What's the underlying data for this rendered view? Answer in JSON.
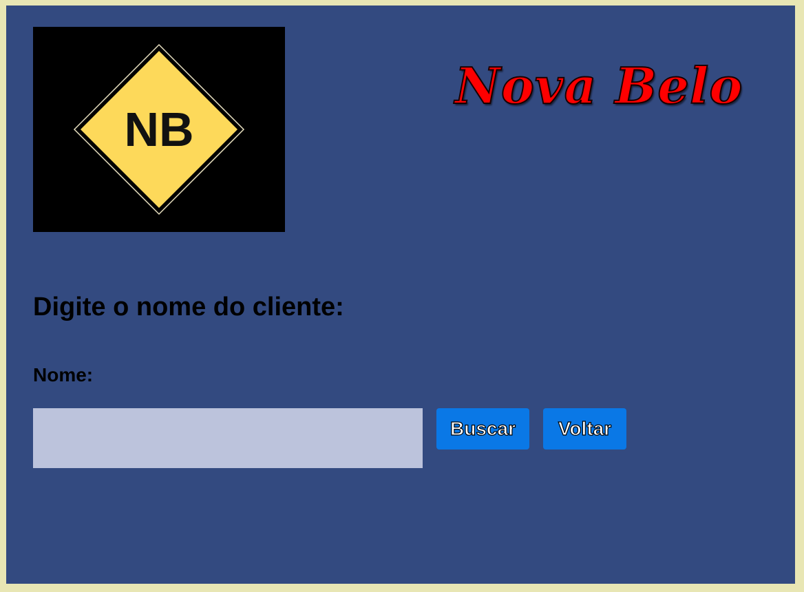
{
  "brand": {
    "logo_text": "NB",
    "title": "Nova Belo"
  },
  "form": {
    "heading": "Digite o nome do cliente:",
    "name_label": "Nome:",
    "name_value": "",
    "name_placeholder": ""
  },
  "actions": {
    "search_label": "Buscar",
    "back_label": "Voltar"
  },
  "colors": {
    "page_border": "#e8e6b4",
    "panel_background": "#334a80",
    "title_red": "#ff0000",
    "logo_yellow": "#fdd95a",
    "input_background": "#bcc3dc",
    "button_blue": "#0a78e6"
  }
}
